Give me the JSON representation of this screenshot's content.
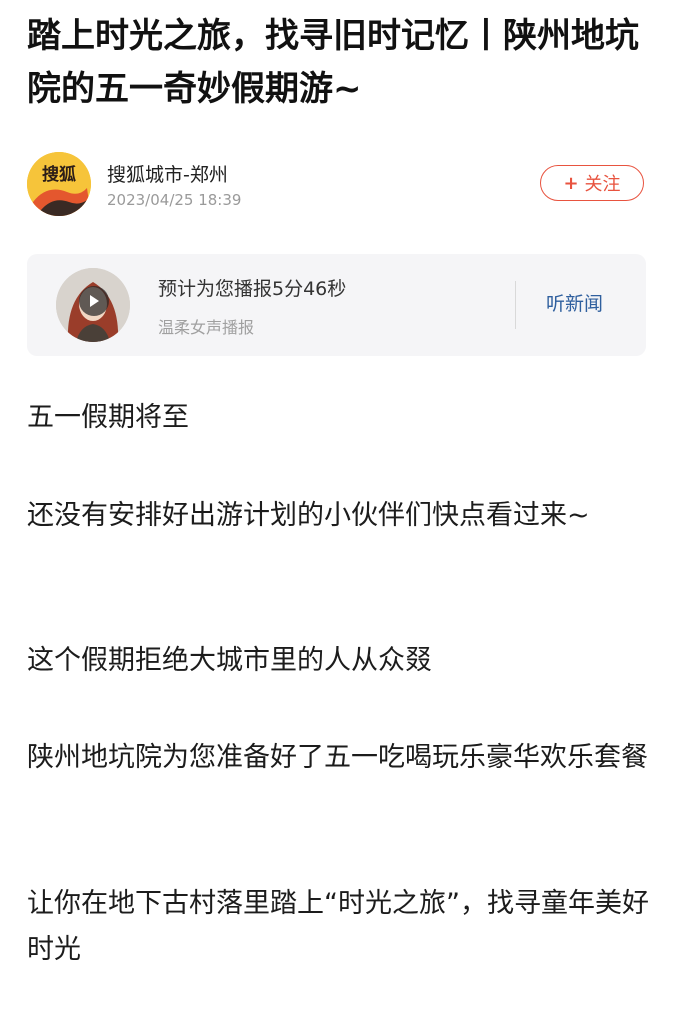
{
  "article": {
    "title": "踏上时光之旅，找寻旧时记忆丨陕州地坑院的五一奇妙假期游~"
  },
  "author": {
    "avatar_text": "搜狐",
    "name": "搜狐城市-郑州",
    "time": "2023/04/25 18:39",
    "follow_plus": "+",
    "follow_label": "关注"
  },
  "audio": {
    "duration_text": "预计为您播报5分46秒",
    "voice_text": "温柔女声播报",
    "listen_label": "听新闻",
    "icon": "play-icon"
  },
  "content": {
    "paragraphs": [
      "五一假期将至",
      "还没有安排好出游计划的小伙伴们快点看过来~",
      "这个假期拒绝大城市里的人从众叕",
      "陕州地坑院为您准备好了五一吃喝玩乐豪华欢乐套餐",
      "让你在地下古村落里踏上“时光之旅”，找寻童年美好时光"
    ]
  },
  "colors": {
    "accent": "#e8533f",
    "link": "#2f5f9e",
    "card_bg": "#f5f5f7"
  }
}
